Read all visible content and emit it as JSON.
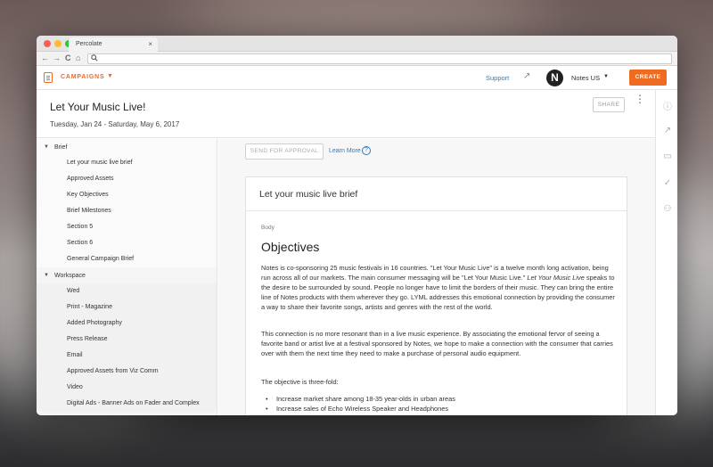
{
  "browser": {
    "tab_title": "Percolate",
    "tab_close": "×",
    "nav": {
      "back": "←",
      "forward": "→",
      "reload": "C",
      "home": "⌂"
    },
    "search_icon": "search-icon"
  },
  "appbar": {
    "section": "CAMPAIGNS",
    "section_caret": "▼",
    "support": "Support",
    "trend_icon": "↗",
    "avatar_letter": "N",
    "account": "Notes US",
    "account_caret": "▼",
    "create": "CREATE"
  },
  "header": {
    "title": "Let Your Music Live!",
    "dates": "Tuesday, Jan 24 - Saturday, May 6, 2017",
    "share": "SHARE",
    "more": "⋮"
  },
  "sidebar": {
    "sections": [
      {
        "label": "Brief",
        "caret": "▼",
        "items": [
          "Let your music live brief",
          "Approved Assets",
          "Key Objectives",
          "Brief Milestones",
          "Section 5",
          "Section 6",
          "General Campaign Brief"
        ]
      },
      {
        "label": "Workspace",
        "caret": "▼",
        "items": [
          "Wed",
          "Print - Magazine",
          "Added Photography",
          "Press Release",
          "Email",
          "Approved Assets from Viz Comm",
          "Video",
          "Digital Ads - Banner Ads on Fader and Complex"
        ]
      }
    ]
  },
  "content": {
    "send_for_approval": "SEND FOR APPROVAL",
    "learn_more": "Learn More",
    "help": "?",
    "card_title": "Let your music live brief",
    "body_label": "Body",
    "heading": "Objectives",
    "para1_a": "Notes is co-sponsoring 25 music festivals in 16 countries. \"Let Your Music Live\" is a twelve month long activation, being run across all of our markets. The main consumer messaging will be \"Let Your Music Live.\" ",
    "para1_em": "Let Your Music Live",
    "para1_b": " speaks to the desire to be surrounded by sound. People no longer have to limit the borders of their music. They can bring the entire line of Notes products with them wherever they go. LYML addresses this emotional connection by providing the consumer a way to share their favorite songs, artists and genres with the rest of the world.",
    "para2": "This connection is no more resonant than in a live music experience. By associating the emotional fervor of seeing a favorite band or artist live at a festival sponsored by Notes, we hope to make a connection with the consumer that carries over with them the next time they need to make a purchase of personal audio equipment.",
    "para3": "The objective is three-fold:",
    "bullets": [
      "Increase market share among 18-35 year-olds in urban areas",
      "Increase sales of Echo Wireless Speaker and Headphones"
    ]
  },
  "right_rail": {
    "icons": [
      "info-icon",
      "trend-icon",
      "comment-icon",
      "check-icon",
      "people-icon"
    ],
    "glyphs": [
      "ⓘ",
      "↗",
      "▭",
      "✓",
      "⚇"
    ]
  },
  "colors": {
    "accent": "#ef6b22",
    "link": "#2e7bbf"
  }
}
